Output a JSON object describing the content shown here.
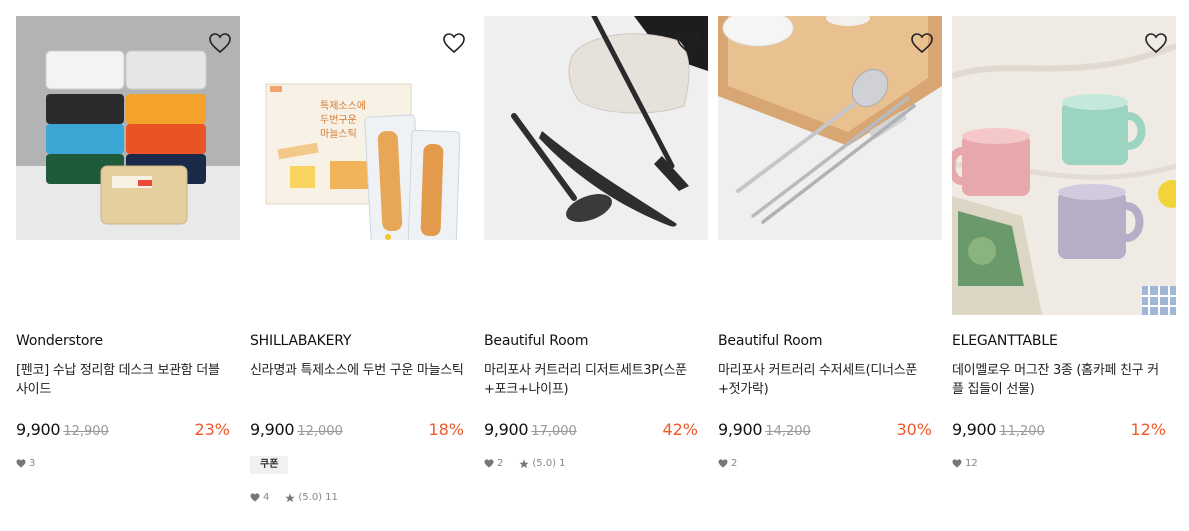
{
  "products": [
    {
      "brand": "Wonderstore",
      "title": "[펜코] 수납 정리함 데스크 보관함 더블 사이드",
      "price": "9,900",
      "original_price": "12,900",
      "discount": "23%",
      "likes": "3"
    },
    {
      "brand": "SHILLABAKERY",
      "title": "신라명과 특제소스에 두번 구운 마늘스틱",
      "price": "9,900",
      "original_price": "12,000",
      "discount": "18%",
      "coupon": "쿠폰",
      "likes": "4",
      "rating": "(5.0)",
      "reviews": "11",
      "image_text": "특제소스에\n두번구운\n마늘스틱"
    },
    {
      "brand": "Beautiful Room",
      "title": "마리포사 커트러리 디저트세트3P(스푼+포크+나이프)",
      "price": "9,900",
      "original_price": "17,000",
      "discount": "42%",
      "likes": "2",
      "rating": "(5.0)",
      "reviews": "1"
    },
    {
      "brand": "Beautiful Room",
      "title": "마리포사 커트러리 수저세트(디너스푼+젓가락)",
      "price": "9,900",
      "original_price": "14,200",
      "discount": "30%",
      "likes": "2"
    },
    {
      "brand": "ELEGANTTABLE",
      "title": "데이멜로우 머그잔 3종 (홈카페 친구 커플 집들이 선물)",
      "price": "9,900",
      "original_price": "11,200",
      "discount": "12%",
      "likes": "12"
    }
  ],
  "colors": {
    "discount": "#f0582a",
    "meta": "#888888"
  }
}
